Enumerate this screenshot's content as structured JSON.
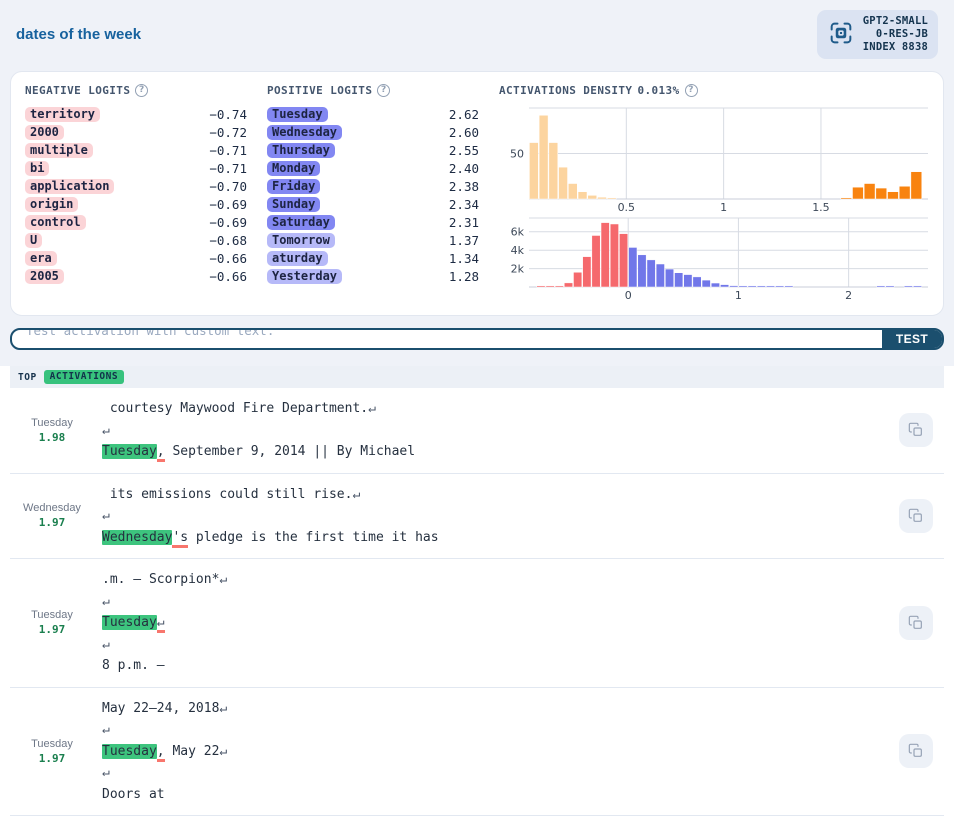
{
  "header": {
    "title": "dates of the week",
    "model": "GPT2-SMALL",
    "layer": "0-RES-JB",
    "index": "INDEX 8838"
  },
  "logits": {
    "negative_title": "NEGATIVE LOGITS",
    "positive_title": "POSITIVE LOGITS",
    "negative": [
      {
        "token": "territory",
        "value": "−0.74"
      },
      {
        "token": "2000",
        "value": "−0.72"
      },
      {
        "token": "multiple",
        "value": "−0.71"
      },
      {
        "token": "bi",
        "value": "−0.71"
      },
      {
        "token": "application",
        "value": "−0.70"
      },
      {
        "token": "origin",
        "value": "−0.69"
      },
      {
        "token": "control",
        "value": "−0.69"
      },
      {
        "token": "U",
        "value": "−0.68"
      },
      {
        "token": "era",
        "value": "−0.66"
      },
      {
        "token": "2005",
        "value": "−0.66"
      }
    ],
    "positive": [
      {
        "token": "Tuesday",
        "value": "2.62",
        "strength": "hi"
      },
      {
        "token": "Wednesday",
        "value": "2.60",
        "strength": "hi"
      },
      {
        "token": "Thursday",
        "value": "2.55",
        "strength": "hi"
      },
      {
        "token": "Monday",
        "value": "2.40",
        "strength": "hi"
      },
      {
        "token": "Friday",
        "value": "2.38",
        "strength": "hi"
      },
      {
        "token": "Sunday",
        "value": "2.34",
        "strength": "hi"
      },
      {
        "token": "Saturday",
        "value": "2.31",
        "strength": "hi"
      },
      {
        "token": "Tomorrow",
        "value": "1.37",
        "strength": "lo"
      },
      {
        "token": "aturday",
        "value": "1.34",
        "strength": "lo"
      },
      {
        "token": "Yesterday",
        "value": "1.28",
        "strength": "lo"
      }
    ]
  },
  "density": {
    "title": "ACTIVATIONS DENSITY",
    "percent": "0.013%"
  },
  "chart_data": [
    {
      "type": "bar",
      "name": "activations-density-histogram",
      "title": "ACTIVATIONS DENSITY 0.013%",
      "xlim": [
        0,
        2.05
      ],
      "ylim": [
        0,
        100
      ],
      "xticks": [
        {
          "v": 0.5,
          "label": "0.5"
        },
        {
          "v": 1,
          "label": "1"
        },
        {
          "v": 1.5,
          "label": "1.5"
        }
      ],
      "yticks": [
        {
          "v": 50,
          "label": "50"
        }
      ],
      "grid": true,
      "series": [
        {
          "name": "low-activation-bins",
          "color": "#fcd49f",
          "binStart": 0.0,
          "binWidth": 0.05,
          "values": [
            62,
            92,
            62,
            35,
            17,
            8,
            4,
            2,
            1
          ]
        },
        {
          "name": "high-activation-bins",
          "color": "#f8830f",
          "binStart": 1.6,
          "binWidth": 0.06,
          "values": [
            1,
            13,
            17,
            12,
            8,
            14,
            30
          ]
        }
      ]
    },
    {
      "type": "bar",
      "name": "logits-density-histogram",
      "title": "",
      "xlim": [
        -0.9,
        2.72
      ],
      "ylim": [
        0,
        7500
      ],
      "xticks": [
        {
          "v": 0,
          "label": "0"
        },
        {
          "v": 1,
          "label": "1"
        },
        {
          "v": 2,
          "label": "2"
        }
      ],
      "yticks": [
        {
          "v": 2000,
          "label": "2k"
        },
        {
          "v": 4000,
          "label": "4k"
        },
        {
          "v": 6000,
          "label": "6k"
        }
      ],
      "grid": true,
      "series": [
        {
          "name": "negative-logit-bins",
          "color": "#f5696d",
          "binStart": -0.8333,
          "binWidth": 0.0833,
          "values": [
            50,
            60,
            90,
            450,
            1600,
            3300,
            5600,
            7000,
            6850,
            5800
          ]
        },
        {
          "name": "positive-logit-bins",
          "color": "#7177e9",
          "binStart": 0,
          "binWidth": 0.0833,
          "values": [
            4300,
            3500,
            2950,
            2500,
            1950,
            1550,
            1350,
            1100,
            750,
            430,
            260,
            150,
            100,
            80,
            70,
            60,
            50,
            40
          ]
        },
        {
          "name": "positive-logit-tail-bins",
          "color": "#7177e9",
          "binStart": 2.25,
          "binWidth": 0.0833,
          "values": [
            25,
            18,
            0,
            15,
            20
          ]
        }
      ]
    }
  ],
  "test": {
    "placeholder": "Test activation with custom text.",
    "button": "TEST"
  },
  "top_bar": {
    "label": "TOP",
    "badge": "ACTIVATIONS"
  },
  "activations": [
    {
      "token": "Tuesday",
      "value": "1.98",
      "lines": [
        [
          {
            "t": " courtesy Maywood Fire Department.",
            "k": "p"
          },
          {
            "t": "↵",
            "k": "r"
          }
        ],
        [
          {
            "t": "↵",
            "k": "r"
          }
        ],
        [
          {
            "t": "Tuesday",
            "k": "h"
          },
          {
            "t": ",",
            "k": "u"
          },
          {
            "t": " September 9, 2014 || By Michael",
            "k": "p"
          }
        ]
      ]
    },
    {
      "token": "Wednesday",
      "value": "1.97",
      "lines": [
        [
          {
            "t": " its emissions could still rise.",
            "k": "p"
          },
          {
            "t": "↵",
            "k": "r"
          }
        ],
        [
          {
            "t": "↵",
            "k": "r"
          }
        ],
        [
          {
            "t": "Wednesday",
            "k": "h"
          },
          {
            "t": "'s",
            "k": "u"
          },
          {
            "t": " pledge is the first time it has",
            "k": "p"
          }
        ]
      ]
    },
    {
      "token": "Tuesday",
      "value": "1.97",
      "lines": [
        [
          {
            "t": ".m. — Scorpion*",
            "k": "p"
          },
          {
            "t": "↵",
            "k": "r"
          }
        ],
        [
          {
            "t": "↵",
            "k": "r"
          }
        ],
        [
          {
            "t": "Tuesday",
            "k": "h"
          },
          {
            "t": "↵",
            "k": "ru"
          }
        ],
        [
          {
            "t": "↵",
            "k": "r"
          }
        ],
        [
          {
            "t": "8 p.m. —",
            "k": "p"
          }
        ]
      ]
    },
    {
      "token": "Tuesday",
      "value": "1.97",
      "lines": [
        [
          {
            "t": "May 22–24, 2018",
            "k": "p"
          },
          {
            "t": "↵",
            "k": "r"
          }
        ],
        [
          {
            "t": "↵",
            "k": "r"
          }
        ],
        [
          {
            "t": "Tuesday",
            "k": "h"
          },
          {
            "t": ",",
            "k": "u"
          },
          {
            "t": " May 22",
            "k": "p"
          },
          {
            "t": "↵",
            "k": "r"
          }
        ],
        [
          {
            "t": "↵",
            "k": "r"
          }
        ],
        [
          {
            "t": "Doors at",
            "k": "p"
          }
        ]
      ]
    }
  ]
}
